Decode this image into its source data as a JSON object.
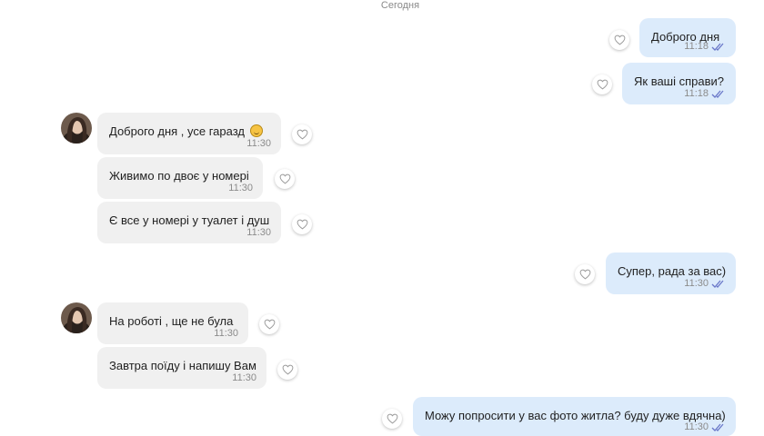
{
  "chat": {
    "date_separator": "Сегодня",
    "messages": [
      {
        "text": "Доброго дня",
        "time": "11:18"
      },
      {
        "text": "Як ваші справи?",
        "time": "11:18"
      },
      {
        "text": "Доброго дня , усе гаразд",
        "time": "11:30",
        "emoji": "smiling-face-emoji"
      },
      {
        "text": "Живимо по двоє у номері",
        "time": "11:30"
      },
      {
        "text": "Є все у номері у туалет і душ",
        "time": "11:30"
      },
      {
        "text": "Супер, рада за вас)",
        "time": "11:30"
      },
      {
        "text": "На роботі , ще не була",
        "time": "11:30"
      },
      {
        "text": "Завтра поїду і напишу Вам",
        "time": "11:30"
      },
      {
        "text": "Можу попросити у вас фото житла? буду дуже вдячна)",
        "time": "11:30"
      }
    ]
  },
  "colors": {
    "incoming_bubble": "#f0f0f0",
    "outgoing_bubble": "#dcebfb",
    "read_check": "#6a78c9"
  },
  "icons": {
    "reaction": "heart-outline-icon",
    "read_status": "double-check-icon"
  }
}
